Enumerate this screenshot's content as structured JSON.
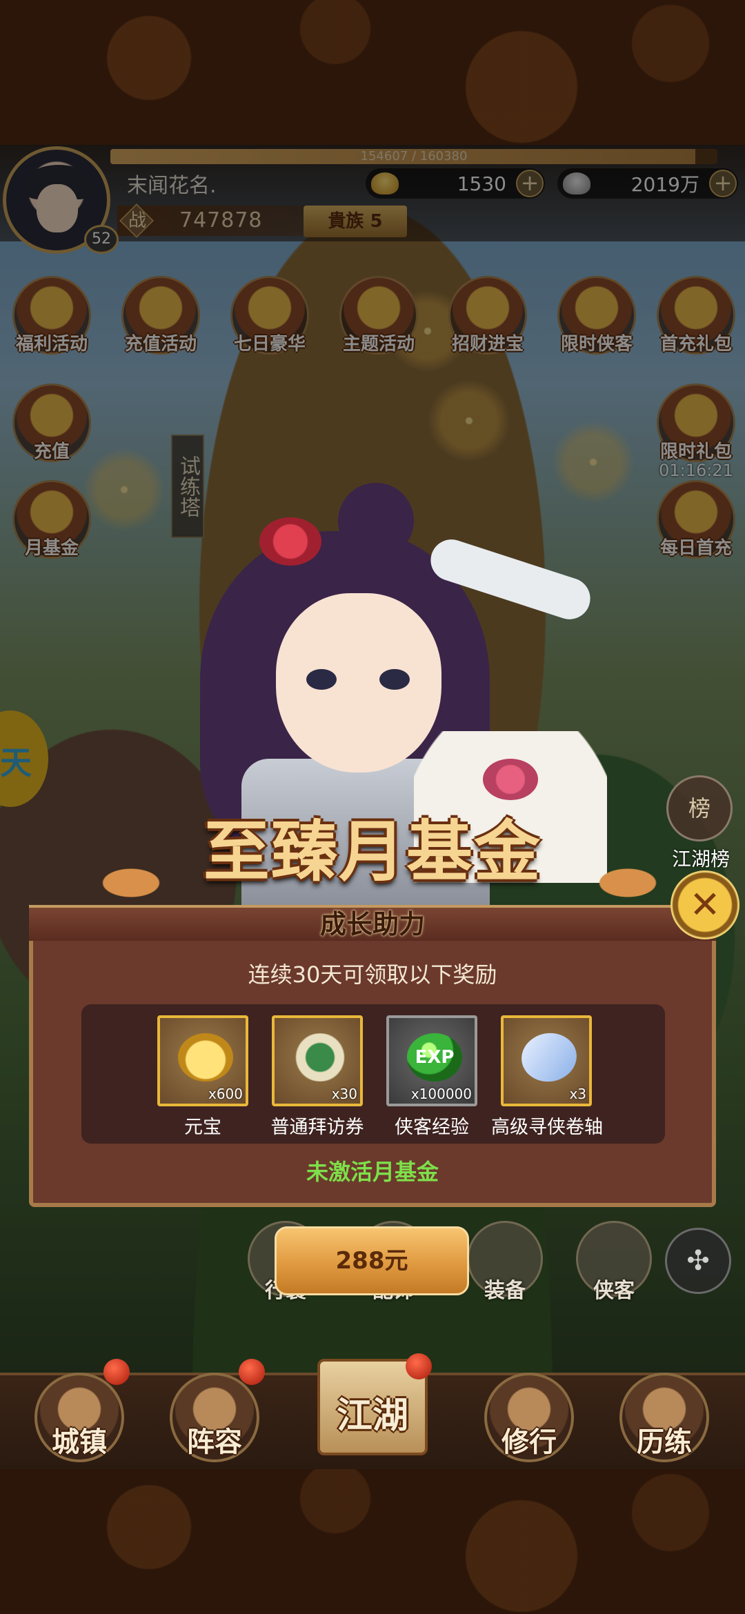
{
  "player": {
    "name": "末闻花名.",
    "level": "52",
    "exp_text": "154607 / 160380",
    "exp_fraction": 0.964,
    "power_glyph": "战",
    "power": "747878",
    "noble": "貴族 5"
  },
  "currencies": {
    "gold": "1530",
    "silver": "2019万",
    "plus": "+"
  },
  "activities": [
    {
      "label": "福利活动"
    },
    {
      "label": "充值活动"
    },
    {
      "label": "七日豪华"
    },
    {
      "label": "主题活动"
    },
    {
      "label": "招财进宝"
    },
    {
      "label": "限时侠客"
    },
    {
      "label": "首充礼包"
    },
    {
      "label": "充值"
    },
    {
      "label": "限时礼包",
      "timer": "01:16:21"
    },
    {
      "label": "月基金"
    },
    {
      "label": "每日首充"
    }
  ],
  "scene": {
    "tower_sign": "试练塔",
    "side_tab_glyph": "天"
  },
  "ranking": {
    "icon_text": "榜",
    "label": "江湖榜"
  },
  "dialog": {
    "title": "至臻月基金",
    "subtitle": "成长助力",
    "close_glyph": "✕",
    "requirement": "连续30天可领取以下奖励",
    "rewards": [
      {
        "name": "元宝",
        "qty": "x600",
        "icon": "gold-ingot-icon"
      },
      {
        "name": "普通拜访券",
        "qty": "x30",
        "icon": "visit-scroll-icon"
      },
      {
        "name": "侠客经验",
        "qty": "x100000",
        "icon": "exp-orb-icon",
        "art_text": "EXP"
      },
      {
        "name": "高级寻侠卷轴",
        "qty": "x3",
        "icon": "search-scroll-icon"
      }
    ],
    "status": "未激活月基金",
    "price": "288元"
  },
  "sub_nav": [
    {
      "label": "行囊"
    },
    {
      "label": "配饰"
    },
    {
      "label": "装备"
    },
    {
      "label": "侠客"
    }
  ],
  "grid_glyph": "✣",
  "main_nav": [
    {
      "label": "城镇"
    },
    {
      "label": "阵容"
    },
    {
      "label": "江湖"
    },
    {
      "label": "修行"
    },
    {
      "label": "历练"
    }
  ],
  "colors": {
    "accent_gold": "#e9b83a",
    "dialog_bg": "#6b3a2c",
    "status_green": "#7ee04a",
    "button_orange": "#e09a40"
  }
}
